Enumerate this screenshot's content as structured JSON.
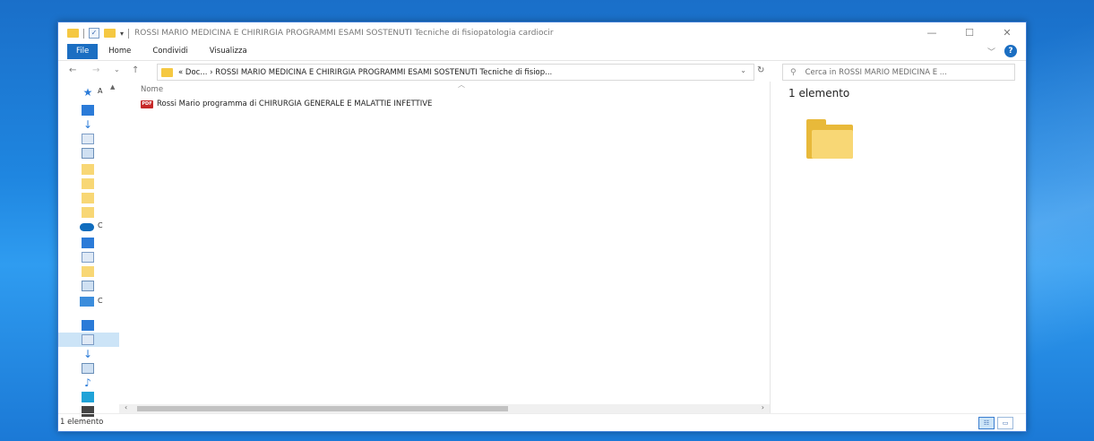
{
  "window": {
    "title": "ROSSI MARIO MEDICINA E CHIRIRGIA PROGRAMMI ESAMI SOSTENUTI Tecniche di fisiopatologia cardiocir",
    "controls": {
      "minimize": "—",
      "maximize": "☐",
      "close": "✕"
    }
  },
  "ribbon": {
    "tabs": [
      "File",
      "Home",
      "Condividi",
      "Visualizza"
    ],
    "help": "?"
  },
  "address": {
    "path": "« Doc... › ROSSI MARIO MEDICINA E CHIRIRGIA PROGRAMMI ESAMI SOSTENUTI Tecniche di fisiop...",
    "search_placeholder": "Cerca in ROSSI MARIO MEDICINA E ..."
  },
  "nav_pane": {
    "truncated_labels": {
      "quick_access": "A",
      "onedrive": "C",
      "this_pc": "C"
    }
  },
  "file_list": {
    "column_header": "Nome",
    "files": [
      {
        "name": "Rossi Mario programma di CHIRURGIA GENERALE E MALATTIE INFETTIVE",
        "type_icon": "pdf-icon",
        "icon_label": "PDF"
      }
    ]
  },
  "preview": {
    "count_text": "1 elemento"
  },
  "status": {
    "text": "1 elemento"
  },
  "colors": {
    "accent": "#1b6ec2",
    "folder": "#f8d775",
    "pdf": "#c62828"
  }
}
